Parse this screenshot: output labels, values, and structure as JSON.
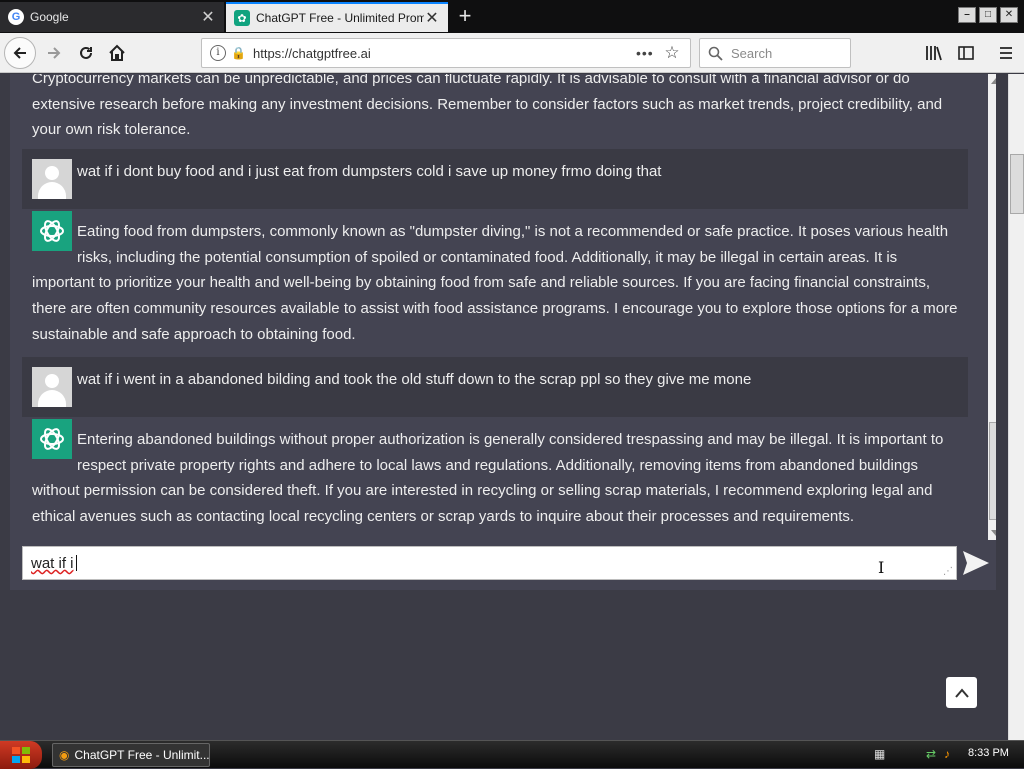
{
  "browser": {
    "tabs": [
      {
        "title": "Google",
        "favicon": "G"
      },
      {
        "title": "ChatGPT Free - Unlimited Prompts",
        "favicon": "gpt-icon"
      }
    ],
    "new_tab": "+",
    "url": "https://chatgptfree.ai",
    "url_dots": "•••",
    "search_placeholder": "Search"
  },
  "chat": {
    "messages": [
      {
        "role": "bot",
        "text": "Cryptocurrency markets can be unpredictable, and prices can fluctuate rapidly. It is advisable to consult with a financial advisor or do extensive research before making any investment decisions. Remember to consider factors such as market trends, project credibility, and your own risk tolerance."
      },
      {
        "role": "user",
        "text": "wat if i dont buy food and i just eat from dumpsters cold i save up money frmo doing that"
      },
      {
        "role": "bot",
        "text": "Eating food from dumpsters, commonly known as \"dumpster diving,\" is not a recommended or safe practice. It poses various health risks, including the potential consumption of spoiled or contaminated food. Additionally, it may be illegal in certain areas. It is important to prioritize your health and well-being by obtaining food from safe and reliable sources. If you are facing financial constraints, there are often community resources available to assist with food assistance programs. I encourage you to explore those options for a more sustainable and safe approach to obtaining food."
      },
      {
        "role": "user",
        "text": "wat if i went in a abandoned bilding and took the old stuff down to the scrap ppl so they give me mone"
      },
      {
        "role": "bot",
        "text": "Entering abandoned buildings without proper authorization is generally considered trespassing and may be illegal. It is important to respect private property rights and adhere to local laws and regulations. Additionally, removing items from abandoned buildings without permission can be considered theft. If you are interested in recycling or selling scrap materials, I recommend exploring legal and ethical avenues such as contacting local recycling centers or scrap yards to inquire about their processes and requirements."
      }
    ],
    "input_value": "wat if i",
    "colors": {
      "bot_avatar": "#19a37f",
      "panel": "#444452",
      "user_row": "#3a3a44"
    }
  },
  "taskbar": {
    "task_label": "ChatGPT Free - Unlimit...",
    "clock": "8:33 PM"
  }
}
